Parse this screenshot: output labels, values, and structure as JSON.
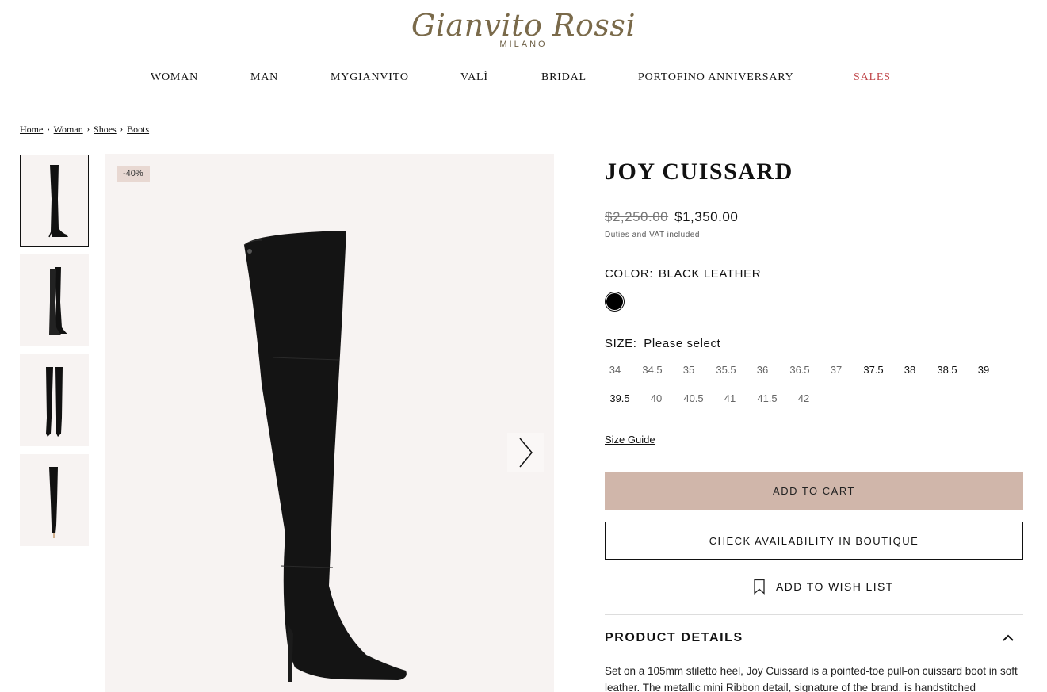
{
  "brand": {
    "name": "Gianvito Rossi",
    "sub": "MILANO"
  },
  "nav": [
    {
      "label": "WOMAN"
    },
    {
      "label": "MAN"
    },
    {
      "label": "MYGIANVITO"
    },
    {
      "label": "VALÌ"
    },
    {
      "label": "BRIDAL"
    },
    {
      "label": "PORTOFINO ANNIVERSARY"
    },
    {
      "label": "SALES"
    }
  ],
  "breadcrumb": [
    "Home",
    "Woman",
    "Shoes",
    "Boots"
  ],
  "gallery": {
    "discount": "-40%",
    "thumbnail_count": 4
  },
  "product": {
    "title": "JOY CUISSARD",
    "old_price": "$2,250.00",
    "price": "$1,350.00",
    "tax_note": "Duties and VAT included",
    "color_label": "COLOR:",
    "color_value": "BLACK LEATHER",
    "swatch_color": "#000000",
    "size_label": "SIZE:",
    "size_value": "Please select",
    "sizes": [
      {
        "label": "34",
        "available": false
      },
      {
        "label": "34.5",
        "available": false
      },
      {
        "label": "35",
        "available": false
      },
      {
        "label": "35.5",
        "available": false
      },
      {
        "label": "36",
        "available": false
      },
      {
        "label": "36.5",
        "available": false
      },
      {
        "label": "37",
        "available": false
      },
      {
        "label": "37.5",
        "available": true
      },
      {
        "label": "38",
        "available": true
      },
      {
        "label": "38.5",
        "available": true
      },
      {
        "label": "39",
        "available": true
      },
      {
        "label": "39.5",
        "available": true
      },
      {
        "label": "40",
        "available": false
      },
      {
        "label": "40.5",
        "available": false
      },
      {
        "label": "41",
        "available": false
      },
      {
        "label": "41.5",
        "available": false
      },
      {
        "label": "42",
        "available": false
      }
    ],
    "size_guide": "Size Guide",
    "add_to_cart": "ADD TO CART",
    "check_boutique": "CHECK AVAILABILITY IN BOUTIQUE",
    "wish_list": "ADD TO WISH LIST",
    "details_title": "PRODUCT DETAILS",
    "details_text": "Set on a 105mm stiletto heel, Joy Cuissard is a pointed-toe pull-on cuissard boot in soft leather. The metallic mini Ribbon detail, signature of the brand, is handstitched"
  },
  "colors": {
    "accent_sales": "#c0464a",
    "cart_button": "#d0b6aa",
    "image_bg": "#f7f3f2",
    "logo": "#7a6a4a"
  }
}
